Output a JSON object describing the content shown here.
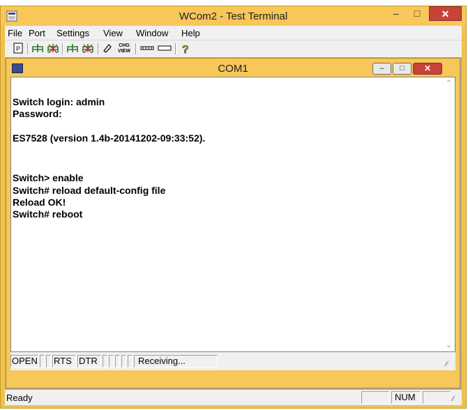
{
  "window": {
    "title": "WCom2 - Test Terminal"
  },
  "menu": [
    "File",
    "Port",
    "Settings",
    "View",
    "Window",
    "Help"
  ],
  "toolbar": {
    "icons": [
      "page-icon",
      "connect-icon",
      "disconnect-icon",
      "connect-all-icon",
      "disconnect-all-icon",
      "eraser-icon",
      "chg-view-icon",
      "port-config-icon",
      "window-icon",
      "help-icon"
    ],
    "chg_view_label_top": "CHG",
    "chg_view_label_bottom": "VIEW"
  },
  "child_window": {
    "title": "COM1"
  },
  "terminal": {
    "lines": [
      "Switch login: admin",
      "Password:",
      "",
      "ES7528 (version 1.4b-20141202-09:33:52).",
      "",
      "",
      "Switch> enable",
      "Switch# reload default-config file",
      "Reload OK!",
      "Switch# reboot"
    ]
  },
  "child_status": {
    "open": "OPEN",
    "rts": "RTS",
    "dtr": "DTR",
    "receiving": "Receiving..."
  },
  "status_bar": {
    "ready": "Ready",
    "num": "NUM"
  },
  "colors": {
    "title_bar": "#f7c75a",
    "close_button": "#c7423a",
    "mdi_background": "#ababab"
  }
}
